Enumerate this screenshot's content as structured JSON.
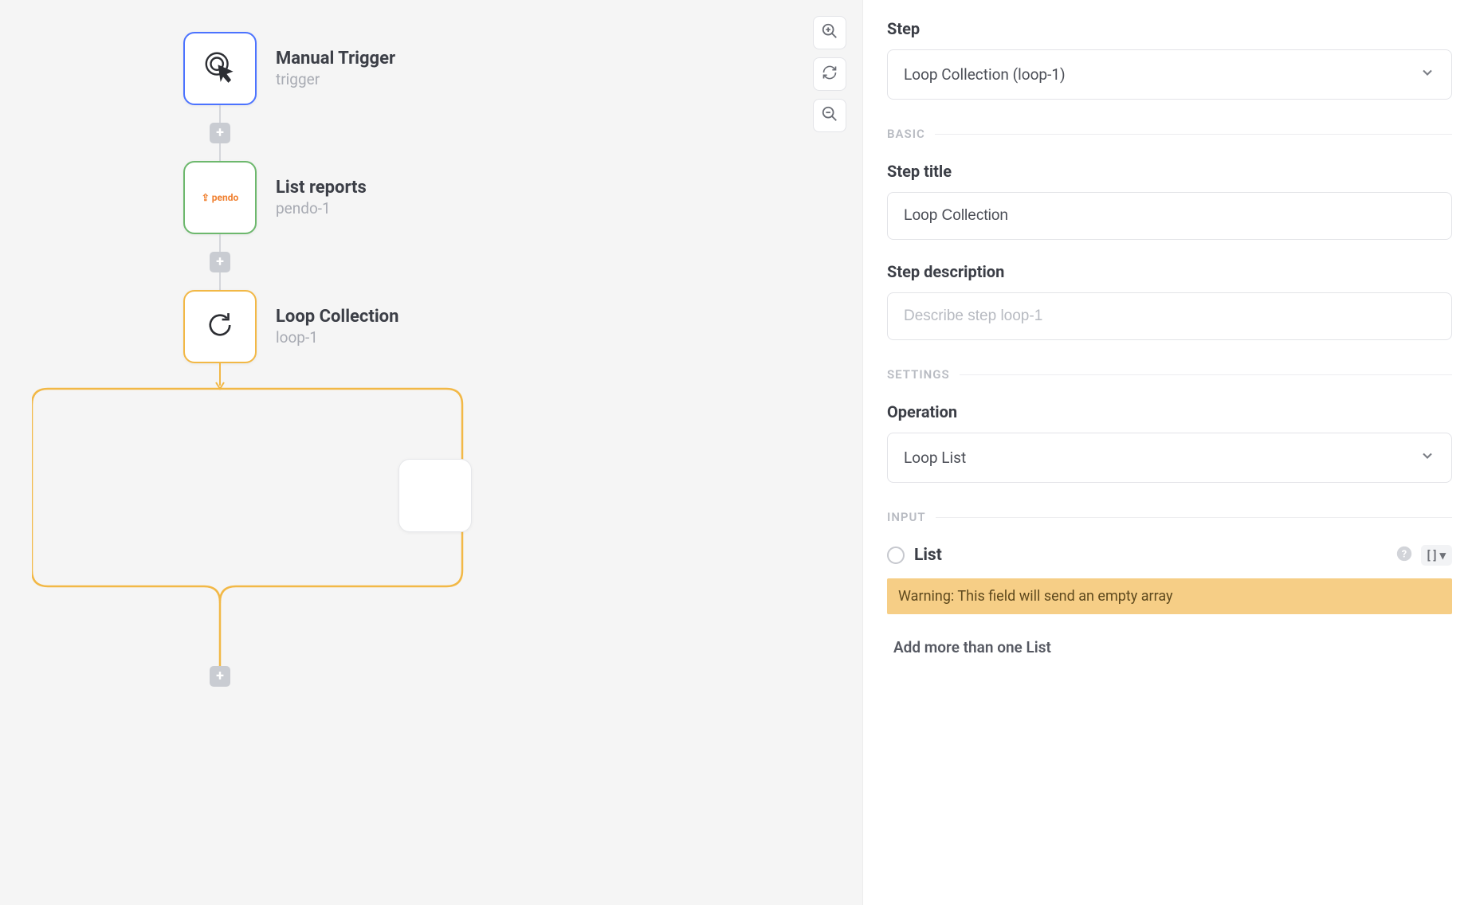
{
  "canvas": {
    "nodes": [
      {
        "title": "Manual Trigger",
        "sub": "trigger"
      },
      {
        "title": "List reports",
        "sub": "pendo-1"
      },
      {
        "title": "Loop Collection",
        "sub": "loop-1"
      }
    ]
  },
  "panel": {
    "step_label": "Step",
    "step_select_value": "Loop Collection (loop-1)",
    "sections": {
      "basic": "BASIC",
      "settings": "SETTINGS",
      "input": "INPUT"
    },
    "step_title_label": "Step title",
    "step_title_value": "Loop Collection",
    "step_desc_label": "Step description",
    "step_desc_placeholder": "Describe step loop-1",
    "operation_label": "Operation",
    "operation_value": "Loop List",
    "input_field_label": "List",
    "brackets": "[ ]",
    "warning": "Warning: This field will send an empty array",
    "add_more": "Add more than one List"
  }
}
